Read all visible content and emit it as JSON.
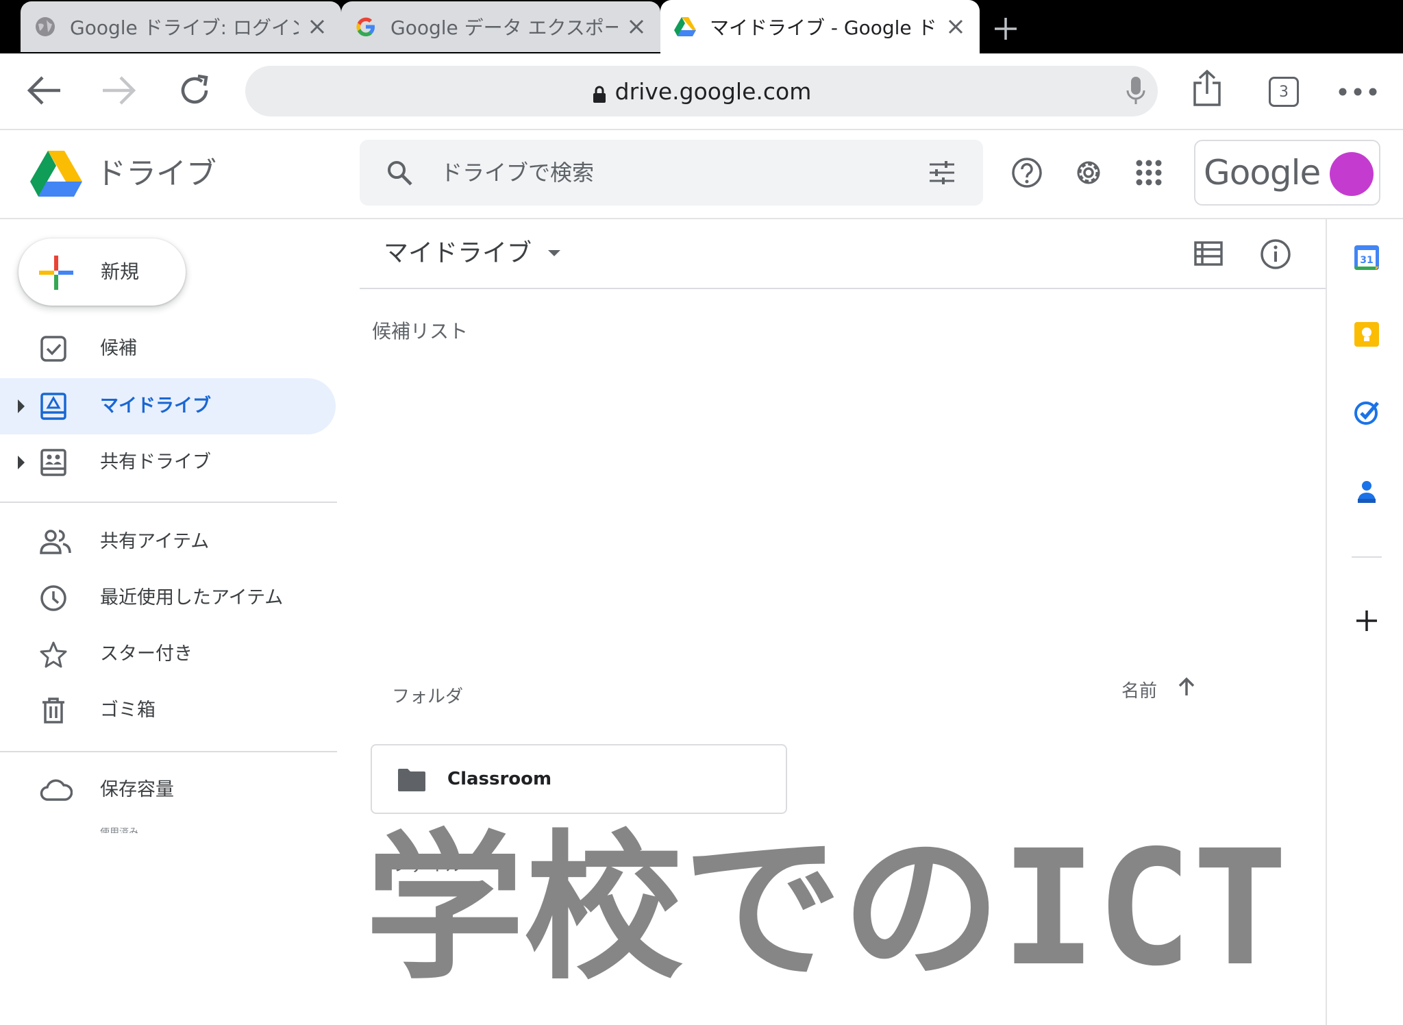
{
  "browser": {
    "tabs": [
      {
        "title": "Google ドライブ: ログイン",
        "favicon": "globe-icon",
        "active": false
      },
      {
        "title": "Google データ エクスポー",
        "favicon": "google-g-icon",
        "active": false
      },
      {
        "title": "マイドライブ - Google ドラ",
        "favicon": "drive-icon",
        "active": true
      }
    ],
    "url": "drive.google.com",
    "tab_count": "3"
  },
  "drive": {
    "app_title": "ドライブ",
    "search_placeholder": "ドライブで検索",
    "account_label": "Google",
    "avatar_color": "#c43ccf",
    "new_button_label": "新規"
  },
  "sidebar": {
    "items": [
      {
        "label": "候補",
        "icon": "suggested-check-icon"
      },
      {
        "label": "マイドライブ",
        "icon": "my-drive-icon",
        "active": true
      },
      {
        "label": "共有ドライブ",
        "icon": "shared-drives-icon"
      },
      {
        "label": "共有アイテム",
        "icon": "people-icon"
      },
      {
        "label": "最近使用したアイテム",
        "icon": "clock-icon"
      },
      {
        "label": "スター付き",
        "icon": "star-icon"
      },
      {
        "label": "ゴミ箱",
        "icon": "trash-icon"
      },
      {
        "label": "保存容量",
        "icon": "cloud-icon"
      }
    ],
    "storage_sub": "使用済み"
  },
  "main": {
    "location": "マイドライブ",
    "suggested_label": "候補リスト",
    "folders_label": "フォルダ",
    "sort_label": "名前",
    "folders": [
      {
        "name": "Classroom"
      }
    ],
    "files_label": "ファイル"
  },
  "overlay": {
    "text": "学校でのICT",
    "color": "#868686"
  },
  "colors": {
    "accent": "#1967d2",
    "active_bg": "#e8f0fe"
  }
}
